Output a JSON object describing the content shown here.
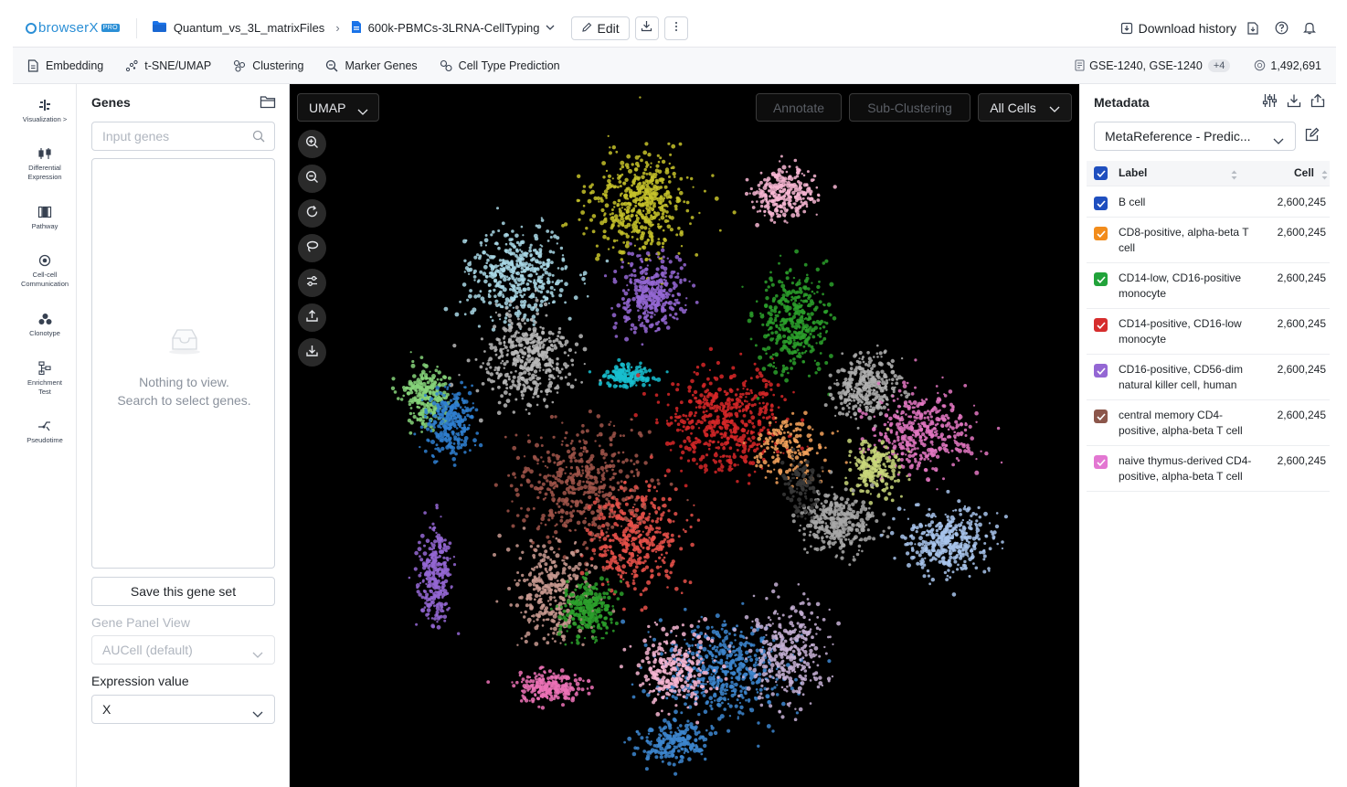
{
  "topbar": {
    "logo_text": "browserX",
    "logo_badge": "PRO",
    "breadcrumb_folder": "Quantum_vs_3L_matrixFiles",
    "breadcrumb_file": "600k-PBMCs-3LRNA-CellTyping",
    "edit_label": "Edit",
    "download_history_label": "Download history"
  },
  "toolbar": {
    "items": [
      "Embedding",
      "t-SNE/UMAP",
      "Clustering",
      "Marker Genes",
      "Cell Type Prediction"
    ],
    "datasets": "GSE-1240, GSE-1240",
    "datasets_more": "+4",
    "cell_count": "1,492,691"
  },
  "leftnav": {
    "items": [
      {
        "label": "Visualization >",
        "icon": "visualization-icon"
      },
      {
        "label": "Differential Expression",
        "icon": "differential-expression-icon"
      },
      {
        "label": "Pathway",
        "icon": "pathway-icon"
      },
      {
        "label": "Cell-cell Communication",
        "icon": "cell-communication-icon"
      },
      {
        "label": "Clonotype",
        "icon": "clonotype-icon"
      },
      {
        "label": "Enrichment Test",
        "icon": "enrichment-test-icon"
      },
      {
        "label": "Pseudotime",
        "icon": "pseudotime-icon"
      }
    ]
  },
  "genes": {
    "title": "Genes",
    "input_placeholder": "Input genes",
    "empty_line1": "Nothing to view.",
    "empty_line2": "Search to select genes.",
    "save_label": "Save this gene set",
    "panel_view_label": "Gene Panel View",
    "panel_view_value": "AUCell (default)",
    "expression_label": "Expression value",
    "expression_value": "X"
  },
  "plot": {
    "embedding": "UMAP",
    "annotate_label": "Annotate",
    "subclustering_label": "Sub-Clustering",
    "cells_filter": "All Cells",
    "tools": [
      "zoom-in-icon",
      "zoom-out-icon",
      "reset-icon",
      "lasso-icon",
      "settings-sliders-icon",
      "upload-icon",
      "download-icon"
    ]
  },
  "metadata": {
    "title": "Metadata",
    "reference": "MetaReference - Predic...",
    "col_label": "Label",
    "col_cell": "Cell",
    "rows": [
      {
        "label": "B cell",
        "count": "2,600,245",
        "color": "#1f4fbf"
      },
      {
        "label": "CD8-positive, alpha-beta T cell",
        "count": "2,600,245",
        "color": "#f28c1b"
      },
      {
        "label": "CD14-low, CD16-positive monocyte",
        "count": "2,600,245",
        "color": "#21a33a"
      },
      {
        "label": "CD14-positive, CD16-low monocyte",
        "count": "2,600,245",
        "color": "#d62d2d"
      },
      {
        "label": "CD16-positive, CD56-dim natural killer cell, human",
        "count": "2,600,245",
        "color": "#9467d4"
      },
      {
        "label": "central memory CD4-positive, alpha-beta T cell",
        "count": "2,600,245",
        "color": "#8c564b"
      },
      {
        "label": "naive thymus-derived CD4-positive, alpha-beta T cell",
        "count": "2,600,245",
        "color": "#e377d2"
      }
    ],
    "header_check_color": "#1f4fbf"
  }
}
